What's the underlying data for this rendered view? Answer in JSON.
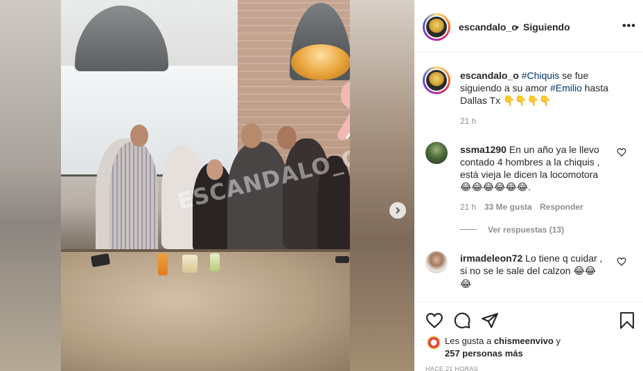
{
  "post": {
    "username": "escandalo_o",
    "separator": "•",
    "follow_status": "Siguiendo",
    "more_icon": "more-horizontal-icon",
    "watermark": "ESCANDALO_O"
  },
  "caption": {
    "username": "escandalo_o",
    "hashtag1": "#Chiquis",
    "text1": " se fue siguiendo a su amor ",
    "hashtag2": "#Emilio",
    "text2": " hasta Dallas Tx ",
    "emojis": "👇👇👇👇",
    "time": "21 h"
  },
  "comments": [
    {
      "username": "ssma1290",
      "line1": " En un año ya le llevo",
      "line2": "contado 4 hombres a la chiquis ,",
      "line3": "está vieja le dicen la locomotora",
      "emojis": "😂😂😂😂😂😂",
      "emoji_tail": ".",
      "time": "21 h",
      "likes": "33 Me gusta",
      "reply": "Responder",
      "view_replies": "Ver respuestas (13)"
    },
    {
      "username": "irmadeleon72",
      "line1": " Lo tiene q cuidar ,",
      "line2": "si no se le sale del calzon ",
      "emojis": "😂😂",
      "line3_emoji": "😂"
    }
  ],
  "actions": {
    "like_icon": "heart-icon",
    "comment_icon": "comment-icon",
    "share_icon": "send-icon",
    "save_icon": "bookmark-icon"
  },
  "likes": {
    "prefix": "Les gusta a ",
    "user": "chismeenvivo",
    "suffix": " y",
    "others": "257 personas más"
  },
  "time_ago": "HACE 21 HORAS",
  "colors": {
    "link": "#00376b",
    "muted": "#8e8e8e",
    "text": "#262626"
  }
}
